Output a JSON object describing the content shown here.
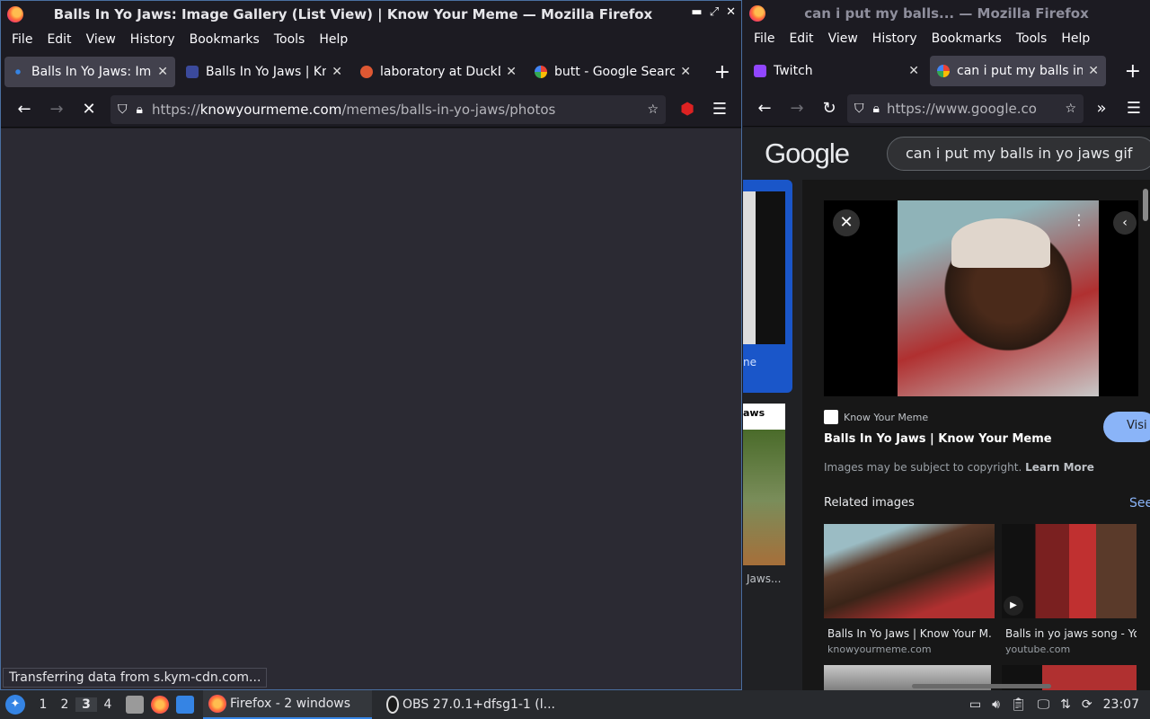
{
  "left_window": {
    "title": "Balls In Yo Jaws: Image Gallery (List View) | Know Your Meme — Mozilla Firefox",
    "menu": [
      "File",
      "Edit",
      "View",
      "History",
      "Bookmarks",
      "Tools",
      "Help"
    ],
    "tabs": [
      {
        "label": "Balls In Yo Jaws: Ima",
        "active": true
      },
      {
        "label": "Balls In Yo Jaws | Kno"
      },
      {
        "label": "laboratory at DuckDu"
      },
      {
        "label": "butt - Google Search"
      }
    ],
    "url_prefix": "https://",
    "url_domain": "knowyourmeme.com",
    "url_path": "/memes/balls-in-yo-jaws/photos",
    "status": "Transferring data from s.kym-cdn.com..."
  },
  "right_window": {
    "title": "can i put my balls... — Mozilla Firefox",
    "menu": [
      "File",
      "Edit",
      "View",
      "History",
      "Bookmarks",
      "Tools",
      "Help"
    ],
    "tabs": [
      {
        "label": "Twitch"
      },
      {
        "label": "can i put my balls in y",
        "active": true
      }
    ],
    "url": "https://www.google.co",
    "google": {
      "logo": "Google",
      "query": "can i put my balls in yo jaws gif",
      "left_thumb_text": "ne",
      "left_thumb2_text": "aws",
      "left_caption": "Jaws...",
      "source_name": "Know Your Meme",
      "image_title": "Balls In Yo Jaws | Know Your Meme",
      "visit_label": "Visi",
      "copyright_text": "Images may be subject to copyright.",
      "learn_more": "Learn More",
      "related_heading": "Related images",
      "see_label": "See",
      "related": [
        {
          "title": "Balls In Yo Jaws | Know Your M...",
          "source": "knowyourmeme.com"
        },
        {
          "title": "Balls in yo jaws song - You",
          "source": "youtube.com"
        }
      ]
    }
  },
  "taskbar": {
    "workspaces": [
      "1",
      "2",
      "3",
      "4"
    ],
    "active_workspace": "3",
    "tasks": [
      {
        "label": "Firefox - 2 windows",
        "active": true
      },
      {
        "label": "OBS 27.0.1+dfsg1-1 (l..."
      }
    ],
    "clock": "23:07"
  }
}
